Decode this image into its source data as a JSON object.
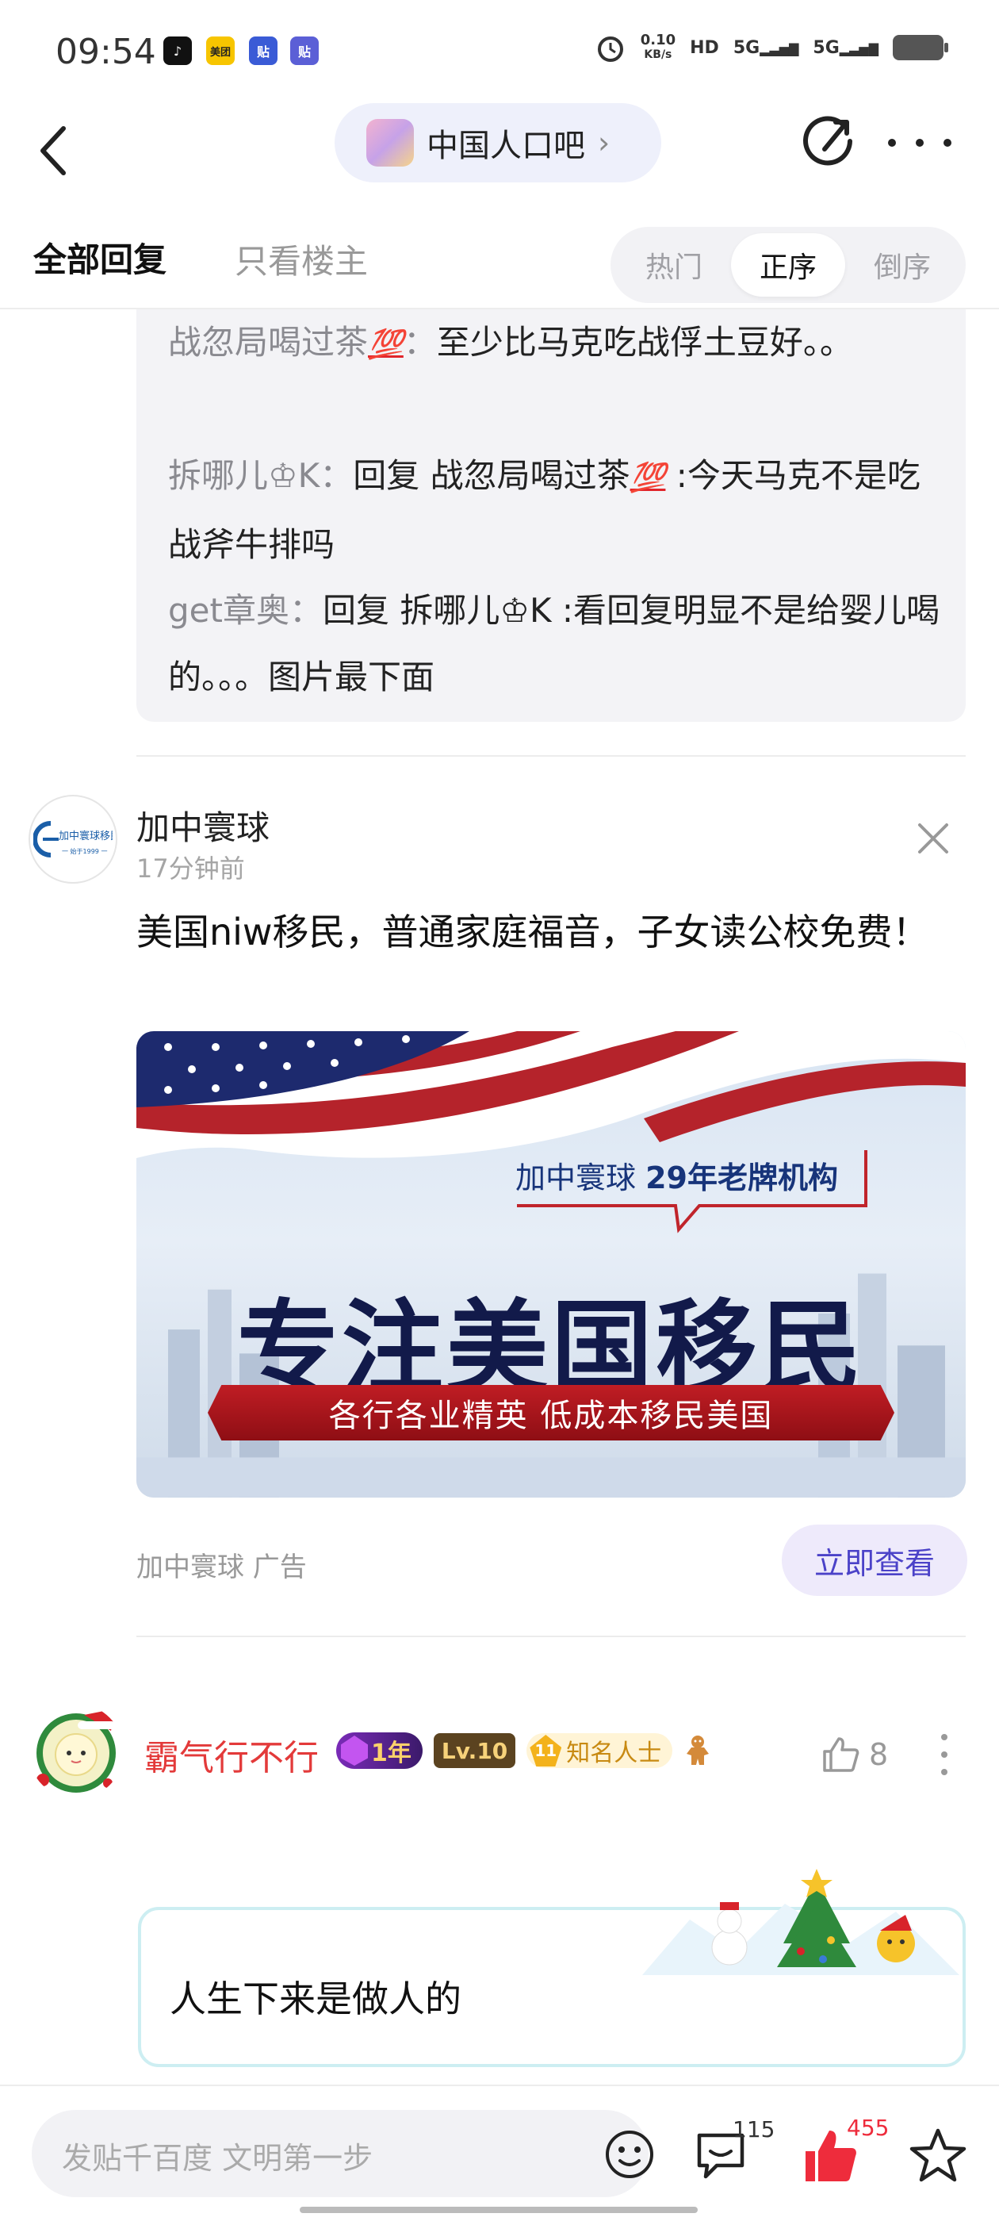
{
  "status_bar": {
    "time": "09:54",
    "app_icons": [
      {
        "name": "tiktok-icon",
        "color": "#111111",
        "glyph": "♪"
      },
      {
        "name": "meituan-icon",
        "color": "#f7c500",
        "glyph": "美团"
      },
      {
        "name": "tieba-icon",
        "color": "#3a5bd6",
        "glyph": "贴"
      },
      {
        "name": "tieba-icon-2",
        "color": "#5b5fd6",
        "glyph": "贴"
      }
    ],
    "net_speed_value": "0.10",
    "net_speed_unit": "KB/s",
    "hd_label": "HD",
    "signal_1": "5G",
    "signal_2": "5G"
  },
  "nav": {
    "forum_name": "中国人口吧",
    "chevron": "›"
  },
  "tabs": {
    "all_replies": "全部回复",
    "owner_only": "只看楼主",
    "sort": [
      {
        "label": "热门",
        "active": false
      },
      {
        "label": "正序",
        "active": true
      },
      {
        "label": "倒序",
        "active": false
      }
    ]
  },
  "sub_replies": [
    {
      "user": "战忽局喝过茶",
      "emoji": "💯",
      "colon": "：",
      "text": "至少比马克吃战俘土豆好。。"
    },
    {
      "user": "拆哪儿♔K",
      "colon": "：",
      "text_prefix": "回复 ",
      "reply_to": "战忽局喝过茶",
      "emoji": "💯",
      "text": " :今天马克不是吃战斧牛排吗"
    },
    {
      "user": "get章奥",
      "colon": "：",
      "text_prefix": "回复 ",
      "reply_to": "拆哪儿♔K",
      "text": " :看回复明显不是给婴儿喝的。。。图片最下面"
    }
  ],
  "ad": {
    "advertiser": "加中寰球",
    "avatar_text": "加中寰球移民",
    "avatar_sub": "一 始于1999 一",
    "time": "17分钟前",
    "text": "美国niw移民，普通家庭福音，子女读公校免费！",
    "banner": {
      "callout_prefix": "加中寰球 ",
      "callout_bold": "29年老牌机构",
      "title": "专注美国移民",
      "ribbon": "各行各业精英  低成本移民美国"
    },
    "source_label": "加中寰球  广告",
    "cta": "立即查看"
  },
  "post": {
    "username": "霸气行不行",
    "badge_year": "1年",
    "badge_level": "Lv.10",
    "badge_title": "知名人士",
    "like_count": "8",
    "content": "人生下来是做人的"
  },
  "bottom_bar": {
    "compose_placeholder": "发贴千百度 文明第一步",
    "comment_count": "115",
    "like_count": "455"
  },
  "colors": {
    "accent_purple": "#4b42c8",
    "like_red": "#ee2c3c",
    "username_red": "#e33a3a"
  }
}
